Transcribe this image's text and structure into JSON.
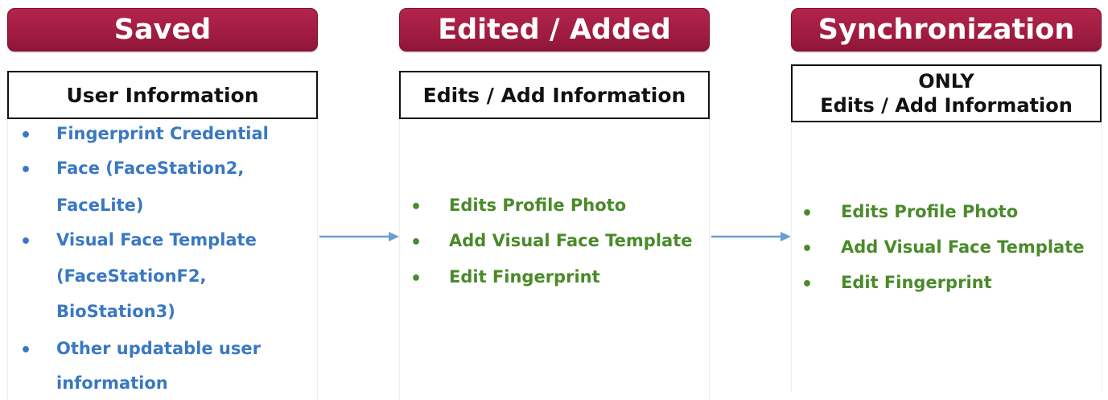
{
  "headers": {
    "saved": "Saved",
    "edited": "Edited / Added",
    "sync": "Synchronization"
  },
  "boxes": {
    "user_info": "User Information",
    "edits_info": "Edits / Add Information",
    "sync_line1": "ONLY",
    "sync_line2": "Edits / Add Information"
  },
  "saved_items": [
    {
      "lines": [
        "Fingerprint Credential"
      ]
    },
    {
      "lines": [
        "Face (FaceStation2,",
        "FaceLite)"
      ]
    },
    {
      "lines": [
        "Visual Face Template",
        "(FaceStationF2,",
        "BioStation3)"
      ]
    },
    {
      "lines": [
        "Other updatable user",
        "information"
      ]
    }
  ],
  "edited_items": [
    "Edits Profile Photo",
    "Add Visual Face Template",
    "Edit Fingerprint"
  ],
  "sync_items": [
    "Edits Profile Photo",
    "Add Visual Face Template",
    "Edit Fingerprint"
  ],
  "bullet_symbol": "•",
  "colors": {
    "header_bg": "#a01c41",
    "saved_text": "#3a78c2",
    "edited_text": "#4a8a2a",
    "arrow": "#6a9fd4"
  }
}
